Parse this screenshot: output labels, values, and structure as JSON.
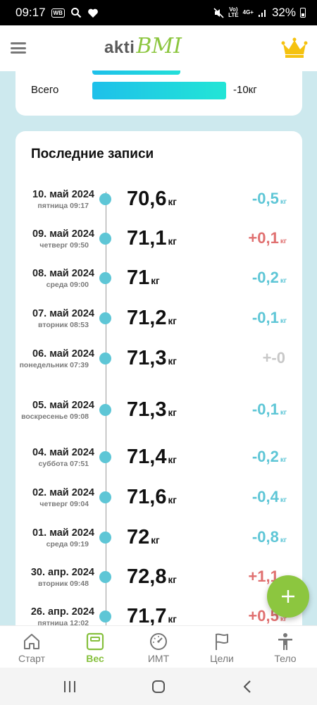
{
  "status_bar": {
    "time": "09:17",
    "app_badge": "WB",
    "network_top": "Vo)",
    "network_bottom": "LTE",
    "signal_label": "4G+",
    "battery": "32%"
  },
  "header": {
    "logo_part1": "akti",
    "logo_part2": "BMI"
  },
  "total": {
    "label": "Всего",
    "value": "-10кг",
    "bar_fraction": 0.66
  },
  "records": {
    "title": "Последние записи",
    "items": [
      {
        "date": "10. май 2024",
        "sub": "пятница 09:17",
        "weight": "70,6",
        "unit": "кг",
        "diff": "-0,5",
        "diff_unit": "кг",
        "trend": "down"
      },
      {
        "date": "09. май 2024",
        "sub": "четверг 09:50",
        "weight": "71,1",
        "unit": "кг",
        "diff": "+0,1",
        "diff_unit": "кг",
        "trend": "up"
      },
      {
        "date": "08. май 2024",
        "sub": "среда 09:00",
        "weight": "71",
        "unit": "кг",
        "diff": "-0,2",
        "diff_unit": "кг",
        "trend": "down"
      },
      {
        "date": "07. май 2024",
        "sub": "вторник 08:53",
        "weight": "71,2",
        "unit": "кг",
        "diff": "-0,1",
        "diff_unit": "кг",
        "trend": "down"
      },
      {
        "date": "06. май 2024",
        "sub": "понедельник 07:39",
        "weight": "71,3",
        "unit": "кг",
        "diff": "+-0",
        "diff_unit": "",
        "trend": "neutral"
      },
      {
        "date": "05. май 2024",
        "sub": "воскресенье 09:08",
        "weight": "71,3",
        "unit": "кг",
        "diff": "-0,1",
        "diff_unit": "кг",
        "trend": "down"
      },
      {
        "date": "04. май 2024",
        "sub": "суббота 07:51",
        "weight": "71,4",
        "unit": "кг",
        "diff": "-0,2",
        "diff_unit": "кг",
        "trend": "down"
      },
      {
        "date": "02. май 2024",
        "sub": "четверг 09:04",
        "weight": "71,6",
        "unit": "кг",
        "diff": "-0,4",
        "diff_unit": "кг",
        "trend": "down"
      },
      {
        "date": "01. май 2024",
        "sub": "среда 09:19",
        "weight": "72",
        "unit": "кг",
        "diff": "-0,8",
        "diff_unit": "кг",
        "trend": "down"
      },
      {
        "date": "30. апр. 2024",
        "sub": "вторник 09:48",
        "weight": "72,8",
        "unit": "кг",
        "diff": "+1,1",
        "diff_unit": "кг",
        "trend": "up"
      },
      {
        "date": "26. апр. 2024",
        "sub": "пятница 12:02",
        "weight": "71,7",
        "unit": "кг",
        "diff": "+0,5",
        "diff_unit": "кг",
        "trend": "up"
      }
    ]
  },
  "colors": {
    "accent_green": "#8cc63f",
    "down": "#5ec6d6",
    "up": "#e07070",
    "neutral": "#c8c8c8"
  },
  "bottom_nav": [
    {
      "label": "Старт",
      "icon": "home-icon",
      "active": false
    },
    {
      "label": "Вес",
      "icon": "scale-icon",
      "active": true
    },
    {
      "label": "ИМТ",
      "icon": "gauge-icon",
      "active": false
    },
    {
      "label": "Цели",
      "icon": "flag-icon",
      "active": false
    },
    {
      "label": "Тело",
      "icon": "body-icon",
      "active": false
    }
  ],
  "fab": {
    "icon": "plus-icon"
  },
  "system_nav": [
    "recents-icon",
    "home-circle-icon",
    "back-icon"
  ]
}
